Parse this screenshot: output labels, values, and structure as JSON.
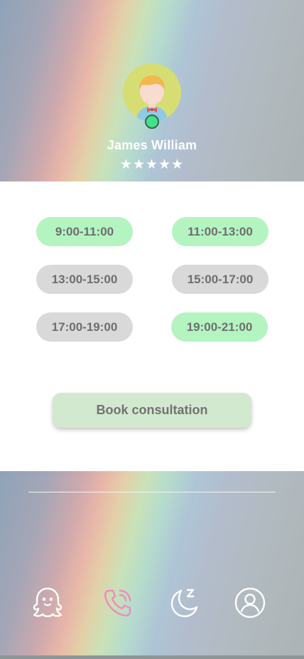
{
  "profile": {
    "name": "James William",
    "rating_stars": "★★★★★",
    "rating": 5,
    "online": true
  },
  "time_slots": [
    {
      "label": "9:00-11:00",
      "status": "available"
    },
    {
      "label": "11:00-13:00",
      "status": "available"
    },
    {
      "label": "13:00-15:00",
      "status": "busy"
    },
    {
      "label": "15:00-17:00",
      "status": "busy"
    },
    {
      "label": "17:00-19:00",
      "status": "busy"
    },
    {
      "label": "19:00-21:00",
      "status": "available"
    }
  ],
  "actions": {
    "book_label": "Book consultation"
  },
  "nav": {
    "items": [
      {
        "icon": "ghost-icon",
        "active": false
      },
      {
        "icon": "phone-call-icon",
        "active": true
      },
      {
        "icon": "moon-sleep-icon",
        "active": false
      },
      {
        "icon": "profile-icon",
        "active": false
      }
    ],
    "active_color": "#f08bbf",
    "inactive_color": "#ffffff"
  },
  "colors": {
    "slot_available": "#b4f4c1",
    "slot_busy": "#d9d9d9",
    "book_button": "#d3e9cf",
    "online_dot": "#45e08a"
  }
}
